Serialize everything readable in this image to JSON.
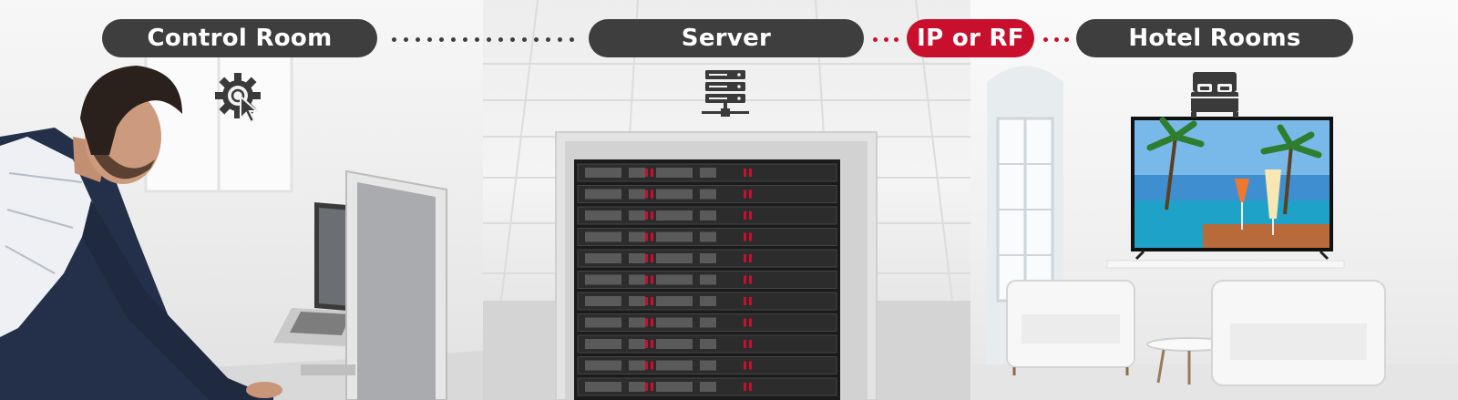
{
  "nodes": [
    {
      "id": "control",
      "label": "Control Room",
      "icon": "gear-cursor-icon"
    },
    {
      "id": "server",
      "label": "Server",
      "icon": "server-network-icon"
    },
    {
      "id": "hotel",
      "label": "Hotel Rooms",
      "icon": "bed-icon"
    }
  ],
  "link": {
    "label": "IP or RF"
  },
  "colors": {
    "pill_dark": "#3e3e3e",
    "accent_red": "#c8102e",
    "pill_text": "#ffffff"
  }
}
